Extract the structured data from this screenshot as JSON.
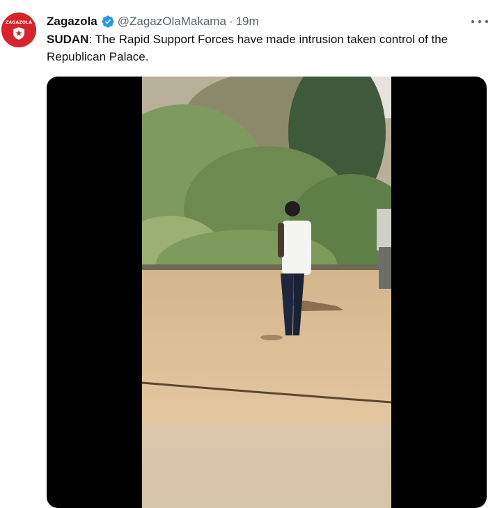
{
  "author": {
    "display_name": "Zagazola",
    "handle": "@ZagazOlaMakama",
    "separator": "·",
    "timestamp": "19m",
    "verified": true,
    "avatar_text": "ZAGAZOLA",
    "avatar_color": "#d8232a"
  },
  "tweet": {
    "text_bold": "SUDAN",
    "text_rest": ": The Rapid Support Forces have made intrusion taken control of the Republican Palace."
  },
  "media": {
    "type": "video"
  },
  "icons": {
    "verified": "verified-badge-icon",
    "more": "more-options-icon"
  },
  "colors": {
    "verified": "#1d9bf0",
    "secondary_text": "#536471",
    "primary_text": "#0f1419"
  }
}
